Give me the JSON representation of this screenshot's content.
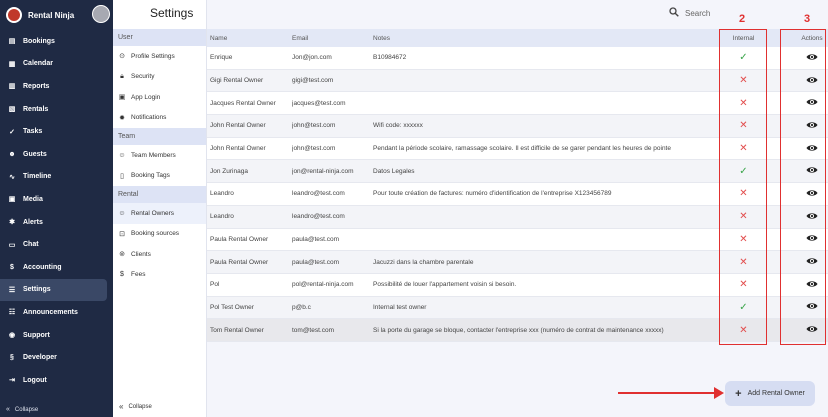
{
  "brand": {
    "name": "Rental Ninja"
  },
  "nav": [
    {
      "label": "Bookings",
      "icon": "bookings-icon"
    },
    {
      "label": "Calendar",
      "icon": "calendar-icon"
    },
    {
      "label": "Reports",
      "icon": "reports-icon"
    },
    {
      "label": "Rentals",
      "icon": "rentals-icon"
    },
    {
      "label": "Tasks",
      "icon": "tasks-icon"
    },
    {
      "label": "Guests",
      "icon": "guests-icon"
    },
    {
      "label": "Timeline",
      "icon": "timeline-icon"
    },
    {
      "label": "Media",
      "icon": "media-icon"
    },
    {
      "label": "Alerts",
      "icon": "alerts-icon"
    },
    {
      "label": "Chat",
      "icon": "chat-icon"
    },
    {
      "label": "Accounting",
      "icon": "accounting-icon"
    },
    {
      "label": "Settings",
      "icon": "settings-icon",
      "active": true
    },
    {
      "label": "Announcements",
      "icon": "announcements-icon"
    },
    {
      "label": "Support",
      "icon": "support-icon"
    },
    {
      "label": "Developer",
      "icon": "developer-icon"
    },
    {
      "label": "Logout",
      "icon": "logout-icon"
    }
  ],
  "nav_collapse": "Collapse",
  "submenu": {
    "sections": [
      {
        "title": "User",
        "items": [
          "Profile Settings",
          "Security",
          "App Login",
          "Notifications"
        ]
      },
      {
        "title": "Team",
        "items": [
          "Team Members",
          "Booking Tags"
        ]
      },
      {
        "title": "Rental",
        "items": [
          "Rental Owners",
          "Booking sources",
          "Clients",
          "Fees"
        ]
      }
    ],
    "active": "Rental Owners",
    "collapse": "Collapse"
  },
  "page": {
    "title": "Settings",
    "search_label": "Search"
  },
  "table": {
    "headers": {
      "name": "Name",
      "email": "Email",
      "notes": "Notes",
      "internal": "Internal",
      "actions": "Actions"
    },
    "rows": [
      {
        "name": "Enrique",
        "email": "Jon@jon.com",
        "notes": "B10984672",
        "internal": true
      },
      {
        "name": "Gigi Rental Owner",
        "email": "gigi@test.com",
        "notes": "",
        "internal": false
      },
      {
        "name": "Jacques Rental Owner",
        "email": "jacques@test.com",
        "notes": "",
        "internal": false
      },
      {
        "name": "John Rental Owner",
        "email": "john@test.com",
        "notes": "Wifi code: xxxxxx",
        "internal": false
      },
      {
        "name": "John Rental Owner",
        "email": "john@test.com",
        "notes": "Pendant la période scolaire, ramassage scolaire. Il est difficile de se garer pendant les heures de pointe",
        "internal": false
      },
      {
        "name": "Jon Zurinaga",
        "email": "jon@rental-ninja.com",
        "notes": "Datos Legales",
        "internal": true
      },
      {
        "name": "Leandro",
        "email": "leandro@test.com",
        "notes": "Pour toute création de factures: numéro d'identification de l'entreprise X123456789",
        "internal": false
      },
      {
        "name": "Leandro",
        "email": "leandro@test.com",
        "notes": "",
        "internal": false
      },
      {
        "name": "Paula Rental Owner",
        "email": "paula@test.com",
        "notes": "",
        "internal": false
      },
      {
        "name": "Paula Rental Owner",
        "email": "paula@test.com",
        "notes": "Jacuzzi dans la chambre parentale",
        "internal": false
      },
      {
        "name": "Pol",
        "email": "pol@rental-ninja.com",
        "notes": "Possibilité de louer l'appartement voisin si besoin.",
        "internal": false
      },
      {
        "name": "Pol Test Owner",
        "email": "p@b.c",
        "notes": "Internal test owner",
        "internal": true
      },
      {
        "name": "Tom Rental Owner",
        "email": "tom@test.com",
        "notes": "Si la porte du garage se bloque, contacter l'entreprise xxx (numéro de contrat de maintenance xxxxx)",
        "internal": false
      }
    ]
  },
  "annotations": {
    "internal_number": "2",
    "actions_number": "3",
    "color": "#e03030"
  },
  "add_button": {
    "label": "Add Rental Owner"
  },
  "colors": {
    "sidebar": "#1f2a44",
    "header_row": "#e3e8f6",
    "yes": "#39a449",
    "no": "#e24d4d"
  }
}
